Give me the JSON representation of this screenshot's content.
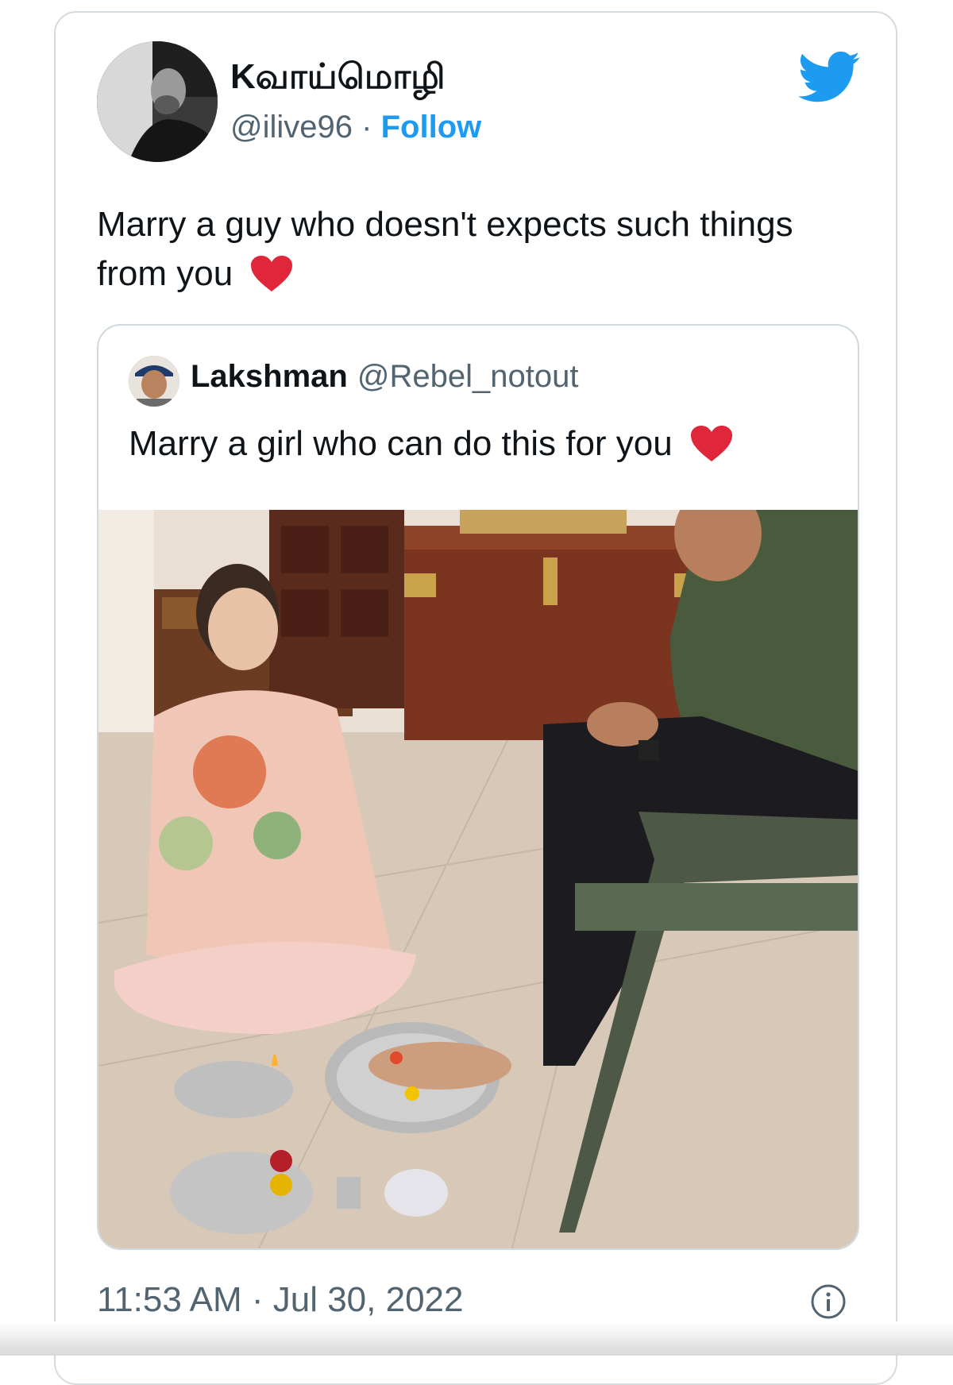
{
  "tweet": {
    "display_name": "Kவாய்மொழி",
    "handle": "@ilive96",
    "separator": "·",
    "follow_label": "Follow",
    "text": "Marry a guy who doesn't expects such things from you",
    "timestamp": "11:53 AM · Jul 30, 2022"
  },
  "quoted_tweet": {
    "display_name": "Lakshman",
    "handle": "@Rebel_notout",
    "text": "Marry a girl who can do this for you"
  },
  "icons": {
    "brand": "twitter-bird-icon",
    "heart": "red-heart-icon",
    "info": "info-icon"
  },
  "colors": {
    "brand": "#1d9bf0",
    "heart": "#e0263a",
    "secondary_text": "#536471",
    "border": "#cfd9de"
  }
}
